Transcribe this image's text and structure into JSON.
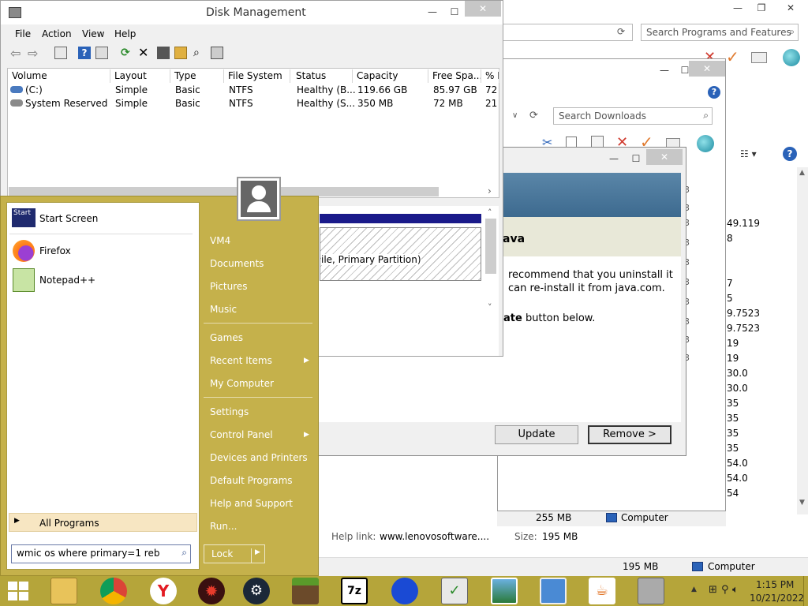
{
  "disk_management": {
    "title": "Disk Management",
    "menu": [
      "File",
      "Action",
      "View",
      "Help"
    ],
    "columns": [
      "Volume",
      "Layout",
      "Type",
      "File System",
      "Status",
      "Capacity",
      "Free Spa...",
      "% F"
    ],
    "rows": [
      [
        "(C:)",
        "Simple",
        "Basic",
        "NTFS",
        "Healthy (B...",
        "119.66 GB",
        "85.97 GB",
        "72"
      ],
      [
        "System Reserved",
        "Simple",
        "Basic",
        "NTFS",
        "Healthy (S...",
        "350 MB",
        "72 MB",
        "21"
      ]
    ],
    "partition_text": "ile, Primary Partition)"
  },
  "programs_window": {
    "search_placeholder": "Search Programs and Features",
    "size_cell": "255 MB",
    "computer_label": "Computer",
    "right_numbers": [
      "49.119",
      "8",
      "7",
      "5",
      "9.7523",
      "9.7523",
      "19",
      "19",
      "30.0",
      "30.0",
      "35",
      "35",
      "35",
      "35",
      "54.0",
      "54.0",
      "54"
    ],
    "help_link_label": "Help link:",
    "help_link_value": "www.lenovosoftware....",
    "size_label": "Size:",
    "size_value": "195 MB"
  },
  "downloads_window": {
    "search_placeholder": "Search Downloads",
    "left_marks": [
      "3",
      "3",
      "3",
      "3",
      "3",
      "3",
      "3",
      "3",
      "3",
      "3"
    ]
  },
  "java_dialog": {
    "heading": "ava",
    "line1": "recommend that you uninstall it",
    "line2": "can re-install it from java.com.",
    "line3_bold": "ate",
    "line3_rest": " button below.",
    "update_button": "Update",
    "remove_button": "Remove >"
  },
  "start_menu": {
    "start_tile_label": "Start",
    "left_items": [
      "Start Screen",
      "Firefox",
      "Notepad++"
    ],
    "all_programs": "All Programs",
    "search_value": "wmic os where primary=1 reb",
    "right_items": [
      "VM4",
      "Documents",
      "Pictures",
      "Music",
      "Games",
      "Recent Items",
      "My Computer",
      "Settings",
      "Control Panel",
      "Devices and Printers",
      "Default Programs",
      "Help and Support",
      "Run..."
    ],
    "lock_label": "Lock"
  },
  "explorer_status": {
    "size": "195 MB",
    "computer": "Computer"
  },
  "taskbar": {
    "time": "1:15 PM",
    "date": "10/21/2022",
    "apps": [
      "explorer",
      "chrome",
      "yandex",
      "avast",
      "steam",
      "minecraft",
      "7zip",
      "sonic",
      "checklist",
      "photos",
      "control-panel",
      "java",
      "printer"
    ],
    "colors": {
      "taskbar": "#b5a53a",
      "start_menu": "#c5b14b",
      "accent": "#1f4e79"
    }
  }
}
